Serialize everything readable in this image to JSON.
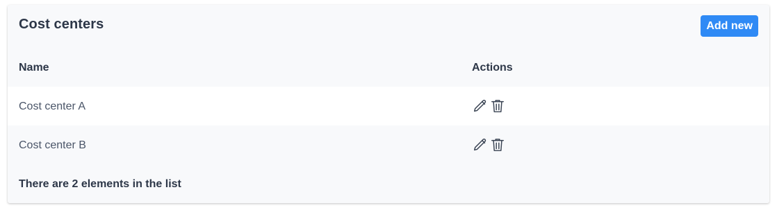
{
  "panel": {
    "title": "Cost centers",
    "add_button_label": "Add new"
  },
  "table": {
    "columns": [
      "Name",
      "Actions"
    ],
    "rows": [
      {
        "name": "Cost center A",
        "actions": [
          "pencil-icon",
          "trash-icon"
        ]
      },
      {
        "name": "Cost center B",
        "actions": [
          "pencil-icon",
          "trash-icon"
        ]
      }
    ]
  },
  "footer": {
    "summary": "There are 2 elements in the list"
  },
  "colors": {
    "accent": "#2f8af5",
    "panel_background": "#f8f9fb",
    "row_background": "#ffffff",
    "text_dark": "#2d3748",
    "text_muted": "#4a5568"
  }
}
